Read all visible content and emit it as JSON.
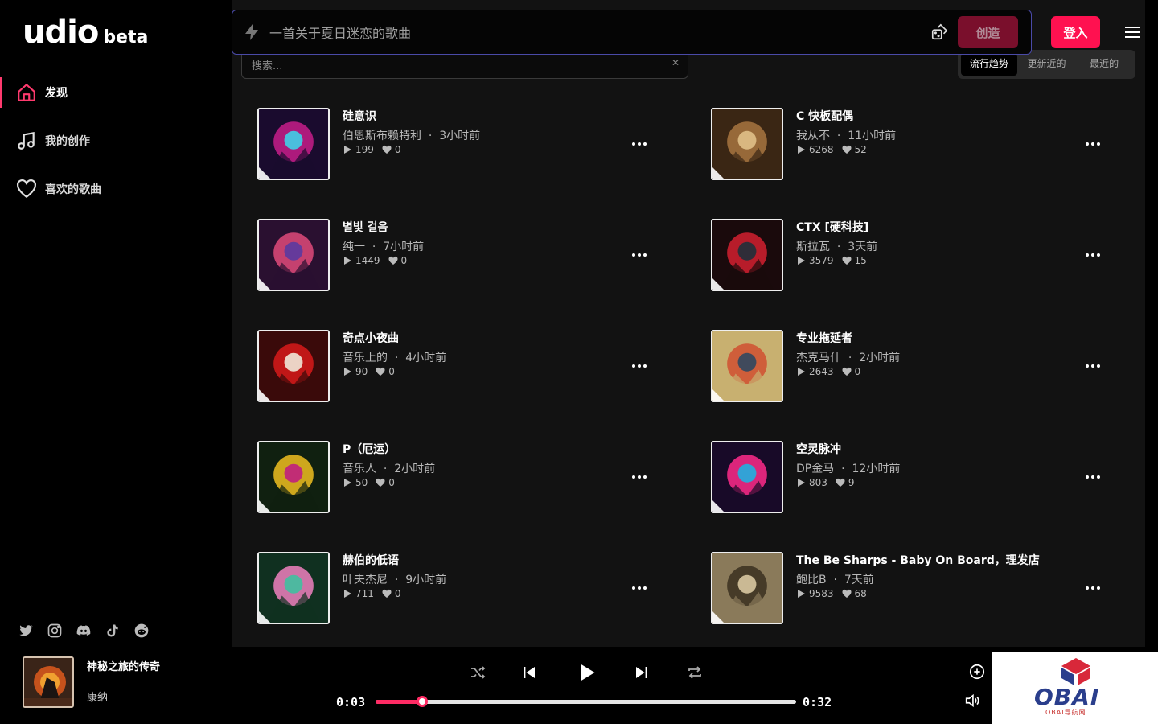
{
  "brand": {
    "name": "udio",
    "badge": "beta"
  },
  "header": {
    "prompt_placeholder": "一首关于夏日迷恋的歌曲",
    "create_label": "创造",
    "login_label": "登入"
  },
  "sidebar": {
    "items": [
      {
        "label": "发现",
        "icon": "home-icon",
        "active": true
      },
      {
        "label": "我的创作",
        "icon": "music-note-icon",
        "active": false
      },
      {
        "label": "喜欢的歌曲",
        "icon": "heart-icon",
        "active": false
      }
    ],
    "socials": [
      "twitter-icon",
      "instagram-icon",
      "discord-icon",
      "tiktok-icon",
      "reddit-icon"
    ]
  },
  "filters": {
    "search_placeholder": "搜索...",
    "sort_tabs": [
      "流行趋势",
      "更新近的",
      "最近的"
    ],
    "active_sort": 0
  },
  "songs": [
    {
      "title": "硅意识",
      "artist": "伯恩斯布赖特利",
      "age": "3小时前",
      "plays": "199",
      "likes": "0"
    },
    {
      "title": "C 快板配偶",
      "artist": "我从不",
      "age": "11小时前",
      "plays": "6268",
      "likes": "52"
    },
    {
      "title": "별빛 걸음",
      "artist": "纯一",
      "age": "7小时前",
      "plays": "1449",
      "likes": "0"
    },
    {
      "title": "CTX [硬科技]",
      "artist": "斯拉瓦",
      "age": "3天前",
      "plays": "3579",
      "likes": "15"
    },
    {
      "title": "奇点小夜曲",
      "artist": "音乐上的",
      "age": "4小时前",
      "plays": "90",
      "likes": "0"
    },
    {
      "title": "专业拖延者",
      "artist": "杰克马什",
      "age": "2小时前",
      "plays": "2643",
      "likes": "0"
    },
    {
      "title": "P（厄运）",
      "artist": "音乐人",
      "age": "2小时前",
      "plays": "50",
      "likes": "0"
    },
    {
      "title": "空灵脉冲",
      "artist": "DP金马",
      "age": "12小时前",
      "plays": "803",
      "likes": "9"
    },
    {
      "title": "赫伯的低语",
      "artist": "叶夫杰尼",
      "age": "9小时前",
      "plays": "711",
      "likes": "0"
    },
    {
      "title": "The Be Sharps - Baby On Board，理发店",
      "artist": "鲍比B",
      "age": "7天前",
      "plays": "9583",
      "likes": "68"
    }
  ],
  "player": {
    "title": "神秘之旅的传奇",
    "artist": "康纳",
    "elapsed": "0:03",
    "duration": "0:32",
    "progress_fraction": 0.11
  },
  "watermark": {
    "text": "OBAI",
    "sub": "OBAI导航网"
  },
  "colors": {
    "accent": "#ff1150",
    "create_bg": "#7a0f2c",
    "panel": "#121212",
    "prompt_border": "#4a4aa8"
  }
}
